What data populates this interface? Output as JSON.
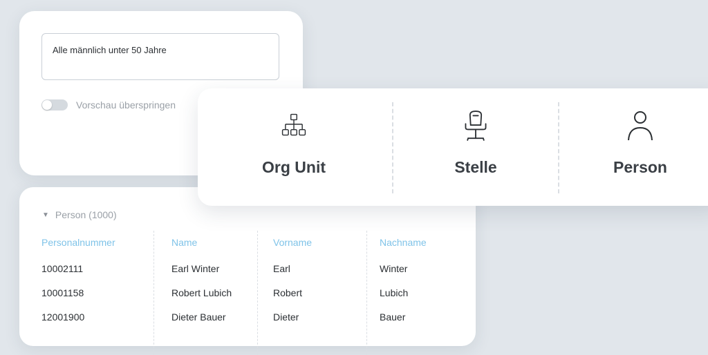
{
  "filter": {
    "query": "Alle männlich unter 50 Jahre",
    "skip_preview_label": "Vorschau überspringen",
    "skip_preview_on": false
  },
  "types": [
    {
      "label": "Org Unit",
      "icon": "org-chart-icon"
    },
    {
      "label": "Stelle",
      "icon": "office-chair-icon"
    },
    {
      "label": "Person",
      "icon": "person-icon"
    }
  ],
  "table": {
    "group_label": "Person (1000)",
    "columns": [
      "Personalnummer",
      "Name",
      "Vorname",
      "Nachname"
    ],
    "rows": [
      [
        "10002111",
        "Earl Winter",
        "Earl",
        "Winter"
      ],
      [
        "10001158",
        "Robert Lubich",
        "Robert",
        "Lubich"
      ],
      [
        "12001900",
        "Dieter Bauer",
        "Dieter",
        "Bauer"
      ]
    ]
  },
  "colors": {
    "background": "#e1e6eb",
    "header_accent": "#7fc3e8",
    "muted_text": "#9aa0a7"
  }
}
